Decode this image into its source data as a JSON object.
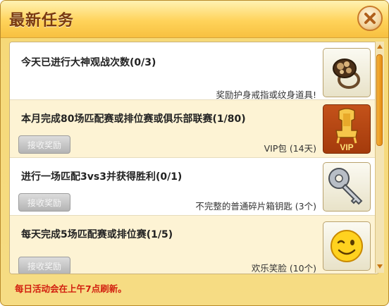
{
  "window": {
    "title": "最新任务",
    "close_icon": "close-x-icon"
  },
  "tasks": [
    {
      "title": "今天已进行大神观战次数(0/3)",
      "reward": "奖励护身戒指或纹身道具!",
      "claim_label": "",
      "icon": "ring-icon"
    },
    {
      "title": "本月完成80场匹配赛或排位赛或俱乐部联赛(1/80)",
      "reward": "VIP包 (14天)",
      "claim_label": "接收奖励",
      "icon": "vip-throne-icon",
      "icon_label": "VIP"
    },
    {
      "title": "进行一场匹配3vs3并获得胜利(0/1)",
      "reward": "不完整的普通碎片箱钥匙 (3个)",
      "claim_label": "接收奖励",
      "icon": "key-icon"
    },
    {
      "title": "每天完成5场匹配赛或排位赛(1/5)",
      "reward": "欢乐笑脸 (10个)",
      "claim_label": "接收奖励",
      "icon": "smiley-wink-icon"
    }
  ],
  "footer": {
    "notice": "每日活动会在上午7点刷新。"
  },
  "colors": {
    "title_text": "#7a3a10",
    "notice_text": "#d21f0f",
    "panel_bg": "#fffdf6",
    "cream_row": "#fdf3d4",
    "scroll_thumb": "#f0a02a"
  }
}
